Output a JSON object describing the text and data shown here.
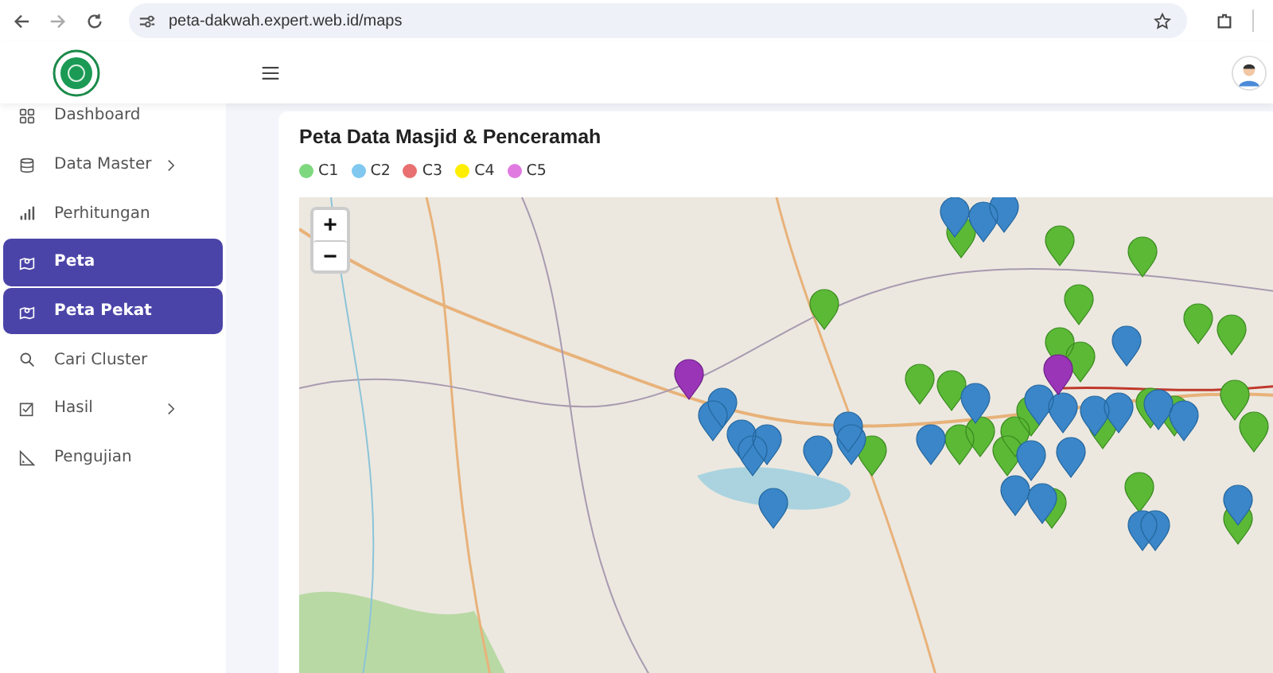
{
  "browser": {
    "url": "peta-dakwah.expert.web.id/maps"
  },
  "sidebar": {
    "items": [
      {
        "label": "Dashboard",
        "selected": false,
        "expandable": false
      },
      {
        "label": "Data Master",
        "selected": false,
        "expandable": true
      },
      {
        "label": "Perhitungan",
        "selected": false,
        "expandable": false
      },
      {
        "label": "Peta",
        "selected": true,
        "expandable": false
      },
      {
        "label": "Peta Pekat",
        "selected": true,
        "expandable": false
      },
      {
        "label": "Cari Cluster",
        "selected": false,
        "expandable": false
      },
      {
        "label": "Hasil",
        "selected": false,
        "expandable": true
      },
      {
        "label": "Pengujian",
        "selected": false,
        "expandable": false
      }
    ]
  },
  "card": {
    "title": "Peta Data Masjid & Penceramah",
    "legend": [
      {
        "label": "C1",
        "color": "#7ed87e"
      },
      {
        "label": "C2",
        "color": "#80c8f0"
      },
      {
        "label": "C3",
        "color": "#e87070"
      },
      {
        "label": "C4",
        "color": "#ffee00"
      },
      {
        "label": "C5",
        "color": "#e07ae0"
      }
    ],
    "map": {
      "kind": "picture",
      "zoom_buttons": [
        "+",
        "−"
      ]
    }
  }
}
